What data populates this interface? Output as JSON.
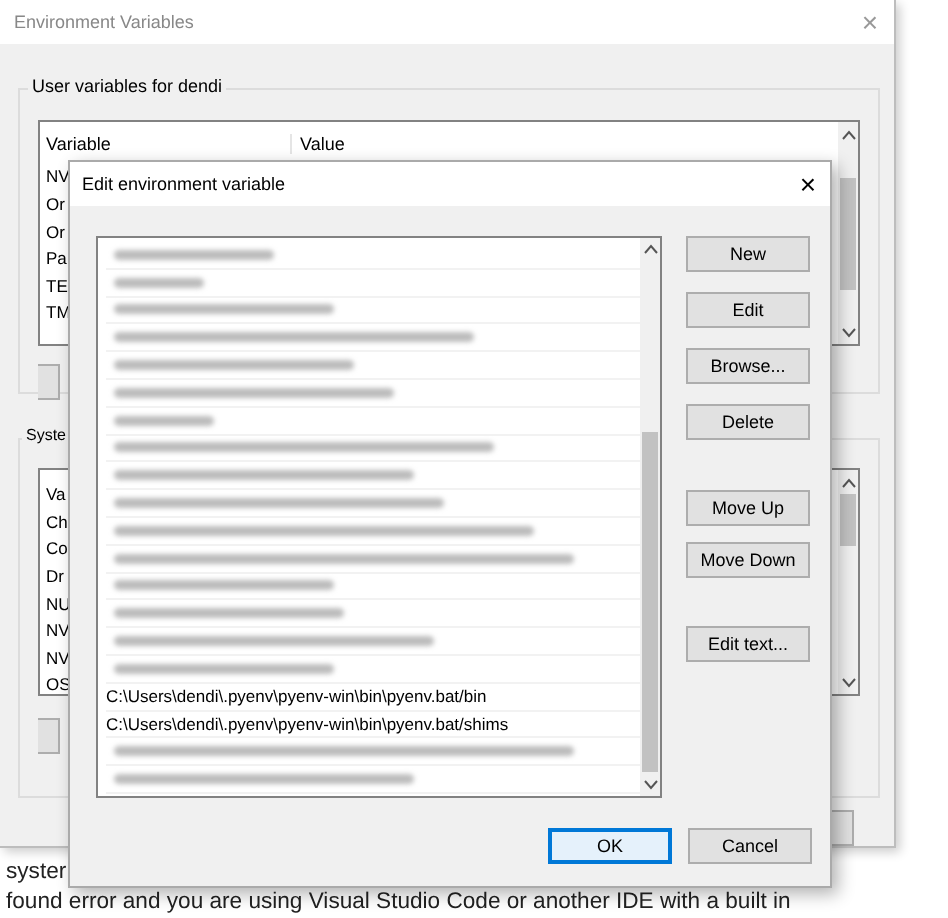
{
  "background_page": {
    "lines": [
      "syster",
      "found error and you are using Visual Studio Code or another IDE with a built in"
    ]
  },
  "back_window": {
    "title": "Environment Variables",
    "close": "×",
    "user_group": {
      "label": "User variables for dendi",
      "columns": [
        "Variable",
        "Value"
      ],
      "rows": [
        "NV",
        "Or",
        "Or",
        "Pa",
        "TE",
        "TM"
      ]
    },
    "system_group": {
      "label": "Syste",
      "rows": [
        "Va",
        "Ch",
        "Co",
        "Dr",
        "NU",
        "NV",
        "NV",
        "OS"
      ]
    }
  },
  "dialog": {
    "title": "Edit environment variable",
    "close": "×",
    "entries": [
      {
        "kind": "blurred"
      },
      {
        "kind": "blurred"
      },
      {
        "kind": "blurred"
      },
      {
        "kind": "blurred"
      },
      {
        "kind": "blurred"
      },
      {
        "kind": "blurred"
      },
      {
        "kind": "blurred"
      },
      {
        "kind": "blurred"
      },
      {
        "kind": "blurred"
      },
      {
        "kind": "blurred"
      },
      {
        "kind": "blurred"
      },
      {
        "kind": "blurred"
      },
      {
        "kind": "blurred"
      },
      {
        "kind": "blurred"
      },
      {
        "kind": "blurred"
      },
      {
        "kind": "blurred"
      },
      {
        "kind": "text",
        "text": "C:\\Users\\dendi\\.pyenv\\pyenv-win\\bin\\pyenv.bat/bin"
      },
      {
        "kind": "text",
        "text": "C:\\Users\\dendi\\.pyenv\\pyenv-win\\bin\\pyenv.bat/shims"
      },
      {
        "kind": "blurred"
      },
      {
        "kind": "blurred"
      }
    ],
    "side_buttons": [
      [
        "New",
        "Edit",
        "Browse...",
        "Delete"
      ],
      [
        "Move Up",
        "Move Down"
      ],
      [
        "Edit text..."
      ]
    ],
    "footer_buttons": [
      {
        "label": "OK",
        "focused": true
      },
      {
        "label": "Cancel",
        "focused": false
      }
    ]
  }
}
